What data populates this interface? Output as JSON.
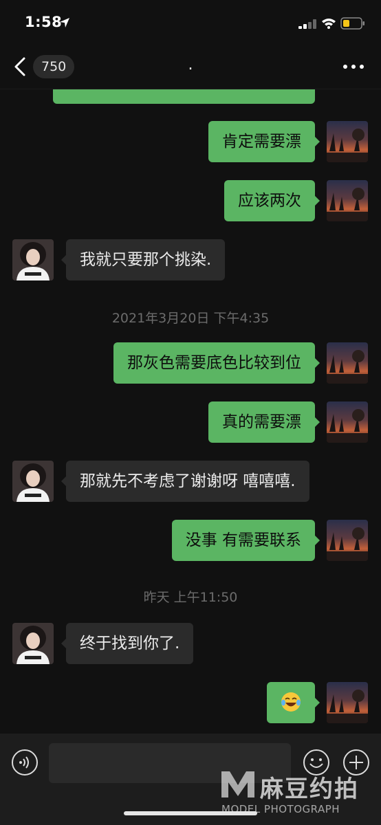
{
  "status_bar": {
    "time": "1:58",
    "icons": [
      "location-arrow-icon",
      "cellular-signal-icon",
      "wifi-icon",
      "battery-icon"
    ]
  },
  "nav": {
    "unread_count": "750",
    "title": ".",
    "back_icon": "chevron-left-icon",
    "more_icon": "more-dots-icon"
  },
  "messages": [
    {
      "type": "out",
      "text": ""
    },
    {
      "type": "out",
      "text": "肯定需要漂"
    },
    {
      "type": "out",
      "text": "应该两次"
    },
    {
      "type": "in",
      "text": "我就只要那个挑染."
    },
    {
      "type": "time",
      "text": "2021年3月20日 下午4:35"
    },
    {
      "type": "out",
      "text": "那灰色需要底色比较到位"
    },
    {
      "type": "out",
      "text": "真的需要漂"
    },
    {
      "type": "in",
      "text": "那就先不考虑了谢谢呀 嘻嘻嘻."
    },
    {
      "type": "out",
      "text": "没事 有需要联系"
    },
    {
      "type": "time",
      "text": "昨天 上午11:50"
    },
    {
      "type": "in",
      "text": "终于找到你了."
    },
    {
      "type": "out",
      "text": "",
      "emoji": "laughing-tears-emoji-icon"
    }
  ],
  "input_bar": {
    "value": "",
    "icons": [
      "voice-icon",
      "emoji-icon",
      "plus-icon"
    ]
  },
  "watermark": {
    "brand": "麻豆约拍",
    "subtitle": "MODEL PHOTOGRAPH"
  },
  "colors": {
    "background": "#111111",
    "outgoing_bubble": "#5bb563",
    "incoming_bubble": "#2b2b2b",
    "timestamp": "#6c6c6c"
  }
}
